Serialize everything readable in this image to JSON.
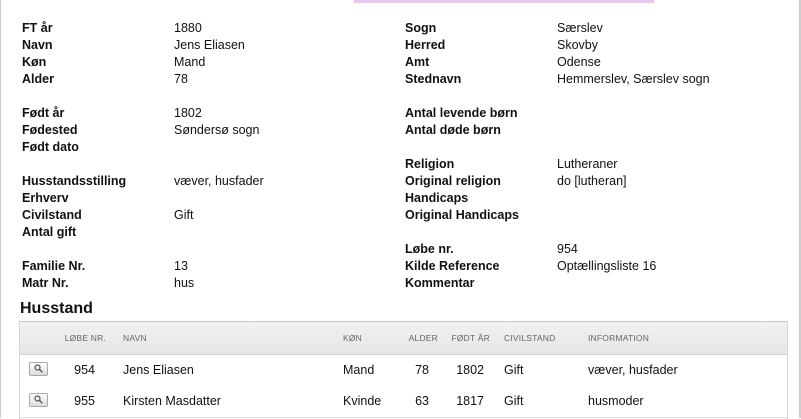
{
  "fields_left": [
    {
      "label": "FT år",
      "value": "1880"
    },
    {
      "label": "Navn",
      "value": "Jens Eliasen"
    },
    {
      "label": "Køn",
      "value": "Mand"
    },
    {
      "label": "Alder",
      "value": "78"
    },
    {
      "label": "Født år",
      "value": "1802"
    },
    {
      "label": "Fødested",
      "value": "Søndersø sogn"
    },
    {
      "label": "Født dato",
      "value": ""
    },
    {
      "label": "Husstandsstilling",
      "value": "væver, husfader"
    },
    {
      "label": "Erhverv",
      "value": ""
    },
    {
      "label": "Civilstand",
      "value": "Gift"
    },
    {
      "label": "Antal gift",
      "value": ""
    },
    {
      "label": "Familie Nr.",
      "value": "13"
    },
    {
      "label": "Matr Nr.",
      "value": "hus"
    }
  ],
  "fields_right": [
    {
      "label": "Sogn",
      "value": "Særslev"
    },
    {
      "label": "Herred",
      "value": "Skovby"
    },
    {
      "label": "Amt",
      "value": "Odense"
    },
    {
      "label": "Stednavn",
      "value": "Hemmerslev, Særslev sogn"
    },
    {
      "label": "Antal levende børn",
      "value": ""
    },
    {
      "label": "Antal døde børn",
      "value": ""
    },
    {
      "label": "Religion",
      "value": "Lutheraner"
    },
    {
      "label": "Original religion",
      "value": "do [lutheran]"
    },
    {
      "label": "Handicaps",
      "value": ""
    },
    {
      "label": "Original Handicaps",
      "value": ""
    },
    {
      "label": "Løbe nr.",
      "value": "954"
    },
    {
      "label": "Kilde Reference",
      "value": "Optællingsliste 16"
    },
    {
      "label": "Kommentar",
      "value": ""
    }
  ],
  "household": {
    "title": "Husstand",
    "columns": {
      "lobe_nr": "LØBE NR.",
      "navn": "NAVN",
      "kon": "KØN",
      "alder": "ALDER",
      "fodt_ar": "FØDT ÅR",
      "civilstand": "CIVILSTAND",
      "information": "INFORMATION"
    },
    "rows": [
      {
        "lobe_nr": "954",
        "navn": "Jens Eliasen",
        "kon": "Mand",
        "alder": "78",
        "fodt_ar": "1802",
        "civilstand": "Gift",
        "information": "væver, husfader",
        "icon": "magnifier-icon"
      },
      {
        "lobe_nr": "955",
        "navn": "Kirsten Masdatter",
        "kon": "Kvinde",
        "alder": "63",
        "fodt_ar": "1817",
        "civilstand": "Gift",
        "information": "husmoder",
        "icon": "magnifier-icon"
      }
    ]
  }
}
